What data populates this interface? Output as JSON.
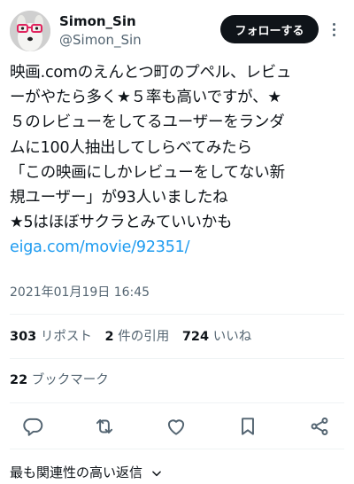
{
  "author": {
    "name": "Simon_Sin",
    "handle": "@Simon_Sin",
    "follow_label": "フォローする"
  },
  "tweet": {
    "lines": [
      "映画.comのえんとつ町のプペル、レビュ",
      "ーがやたら多く★５率も高いですが、★",
      "５のレビューをしてるユーザーをランダ",
      "ムに100人抽出してしらべてみたら",
      "「この映画にしかレビューをしてない新",
      "規ユーザー」が93人いましたね",
      "★5はほぼサクラとみていいかも"
    ],
    "link": "eiga.com/movie/92351/",
    "timestamp": "2021年01月19日 16:45"
  },
  "stats": {
    "reposts": {
      "count": "303",
      "label": "リポスト"
    },
    "quotes": {
      "count": "2",
      "label": "件の引用"
    },
    "likes": {
      "count": "724",
      "label": "いいね"
    },
    "bookmarks": {
      "count": "22",
      "label": "ブックマーク"
    }
  },
  "actions": [
    "reply-icon",
    "repost-icon",
    "like-icon",
    "bookmark-icon",
    "share-icon"
  ],
  "replies_sort": {
    "label": "最も関連性の高い返信"
  },
  "colors": {
    "text": "#0f1419",
    "secondary": "#536471",
    "link": "#1d9bf0",
    "button": "#0f1419",
    "divider": "#eff3f4"
  }
}
